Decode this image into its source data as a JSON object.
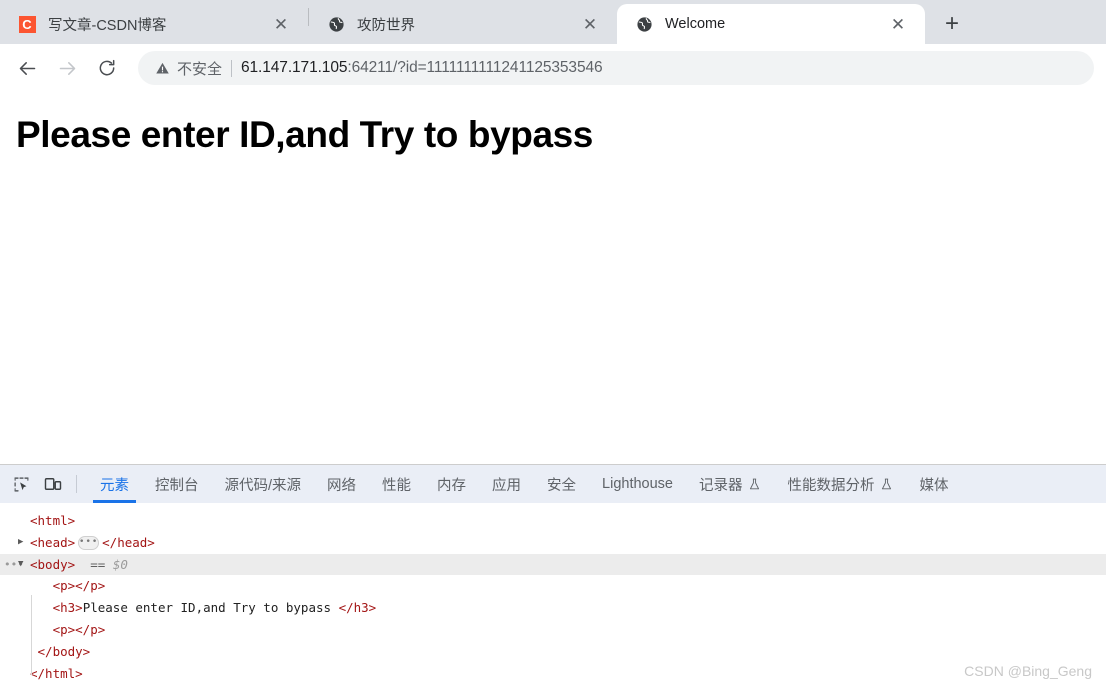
{
  "browser": {
    "tabs": [
      {
        "title": "写文章-CSDN博客",
        "favicon": "csdn-icon",
        "active": false,
        "close_label": "✕"
      },
      {
        "title": "攻防世界",
        "favicon": "globe-icon",
        "active": false,
        "close_label": "✕"
      },
      {
        "title": "Welcome",
        "favicon": "globe-icon",
        "active": true,
        "close_label": "✕"
      }
    ],
    "new_tab_label": "+",
    "nav": {
      "back": "back-arrow-icon",
      "forward": "forward-arrow-icon",
      "reload": "reload-icon"
    },
    "omnibox": {
      "security_label": "不安全",
      "security_icon": "warning-triangle-icon",
      "url_host": "61.147.171.105",
      "url_rest": ":64211/?id=1111111111241125353546",
      "url_full": "61.147.171.105:64211/?id=1111111111241125353546"
    }
  },
  "page": {
    "heading": "Please enter ID,and Try to bypass"
  },
  "devtools": {
    "tools": {
      "inspect_icon": "inspect-element-icon",
      "device_icon": "device-toolbar-icon"
    },
    "tabs": [
      {
        "label": "元素",
        "active": true,
        "flask": false
      },
      {
        "label": "控制台",
        "active": false,
        "flask": false
      },
      {
        "label": "源代码/来源",
        "active": false,
        "flask": false
      },
      {
        "label": "网络",
        "active": false,
        "flask": false
      },
      {
        "label": "性能",
        "active": false,
        "flask": false
      },
      {
        "label": "内存",
        "active": false,
        "flask": false
      },
      {
        "label": "应用",
        "active": false,
        "flask": false
      },
      {
        "label": "安全",
        "active": false,
        "flask": false
      },
      {
        "label": "Lighthouse",
        "active": false,
        "flask": false
      },
      {
        "label": "记录器",
        "active": false,
        "flask": true
      },
      {
        "label": "性能数据分析",
        "active": false,
        "flask": true
      },
      {
        "label": "媒体",
        "active": false,
        "flask": false
      }
    ],
    "dom": {
      "line1": "<html>",
      "line2_open": "<head>",
      "line2_badge": "•••",
      "line2_close": "</head>",
      "line3_tag": "<body>",
      "line3_eq": "==",
      "line3_ref": "$0",
      "line4": "<p></p>",
      "line5_open": "<h3>",
      "line5_text": "Please enter ID,and Try to bypass ",
      "line5_close": "</h3>",
      "line6": "<p></p>",
      "line7": "</body>",
      "line8": "</html>",
      "gutter_dots": "•••"
    }
  },
  "watermark": "CSDN @Bing_Geng"
}
